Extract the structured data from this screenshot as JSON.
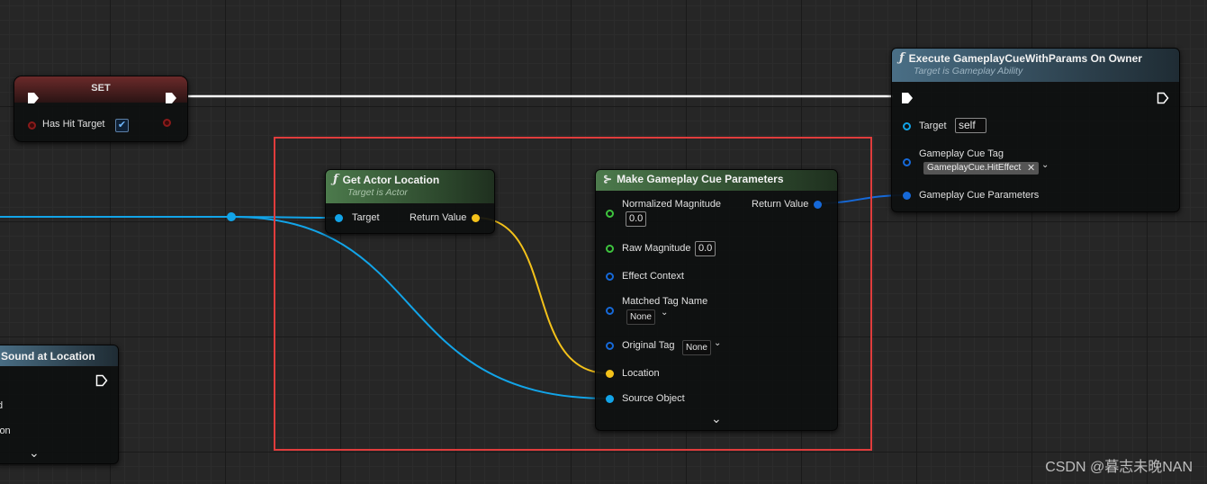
{
  "set_node": {
    "title": "SET",
    "pin_has_hit_target": "Has Hit Target",
    "checked_glyph": "✔"
  },
  "get_actor_location": {
    "title": "Get Actor Location",
    "subtitle": "Target is Actor",
    "pin_target": "Target",
    "pin_return": "Return Value"
  },
  "make_cue_params": {
    "title": "Make Gameplay Cue Parameters",
    "pin_normalized_magnitude": "Normalized Magnitude",
    "normalized_magnitude_value": "0.0",
    "pin_return": "Return Value",
    "pin_raw_magnitude": "Raw Magnitude",
    "raw_magnitude_value": "0.0",
    "pin_effect_context": "Effect Context",
    "pin_matched_tag_name": "Matched Tag Name",
    "matched_tag_name_value": "None",
    "pin_original_tag": "Original Tag",
    "original_tag_value": "None",
    "pin_location": "Location",
    "pin_source_object": "Source Object"
  },
  "execute_cue": {
    "title": "Execute GameplayCueWithParams On Owner",
    "subtitle": "Target is Gameplay Ability",
    "pin_target": "Target",
    "target_value": "self",
    "pin_cue_tag": "Gameplay Cue Tag",
    "cue_tag_value": "GameplayCue.HitEffect",
    "pin_cue_params": "Gameplay Cue Parameters"
  },
  "sound_node": {
    "title_partial": "Sound at Location",
    "row1_partial": "d",
    "row2_partial": "ion"
  },
  "icons": {
    "function": "ƒ",
    "make_struct": "⊱",
    "close": "✕",
    "chevron_down": "⌄"
  },
  "watermark": "CSDN @暮志未晚NAN",
  "colors": {
    "exec_wire": "#ffffff",
    "object_wire": "#12a4e8",
    "vector_wire": "#f4c21a",
    "struct_wire": "#1669d8",
    "highlight_box": "#e03c3c"
  }
}
